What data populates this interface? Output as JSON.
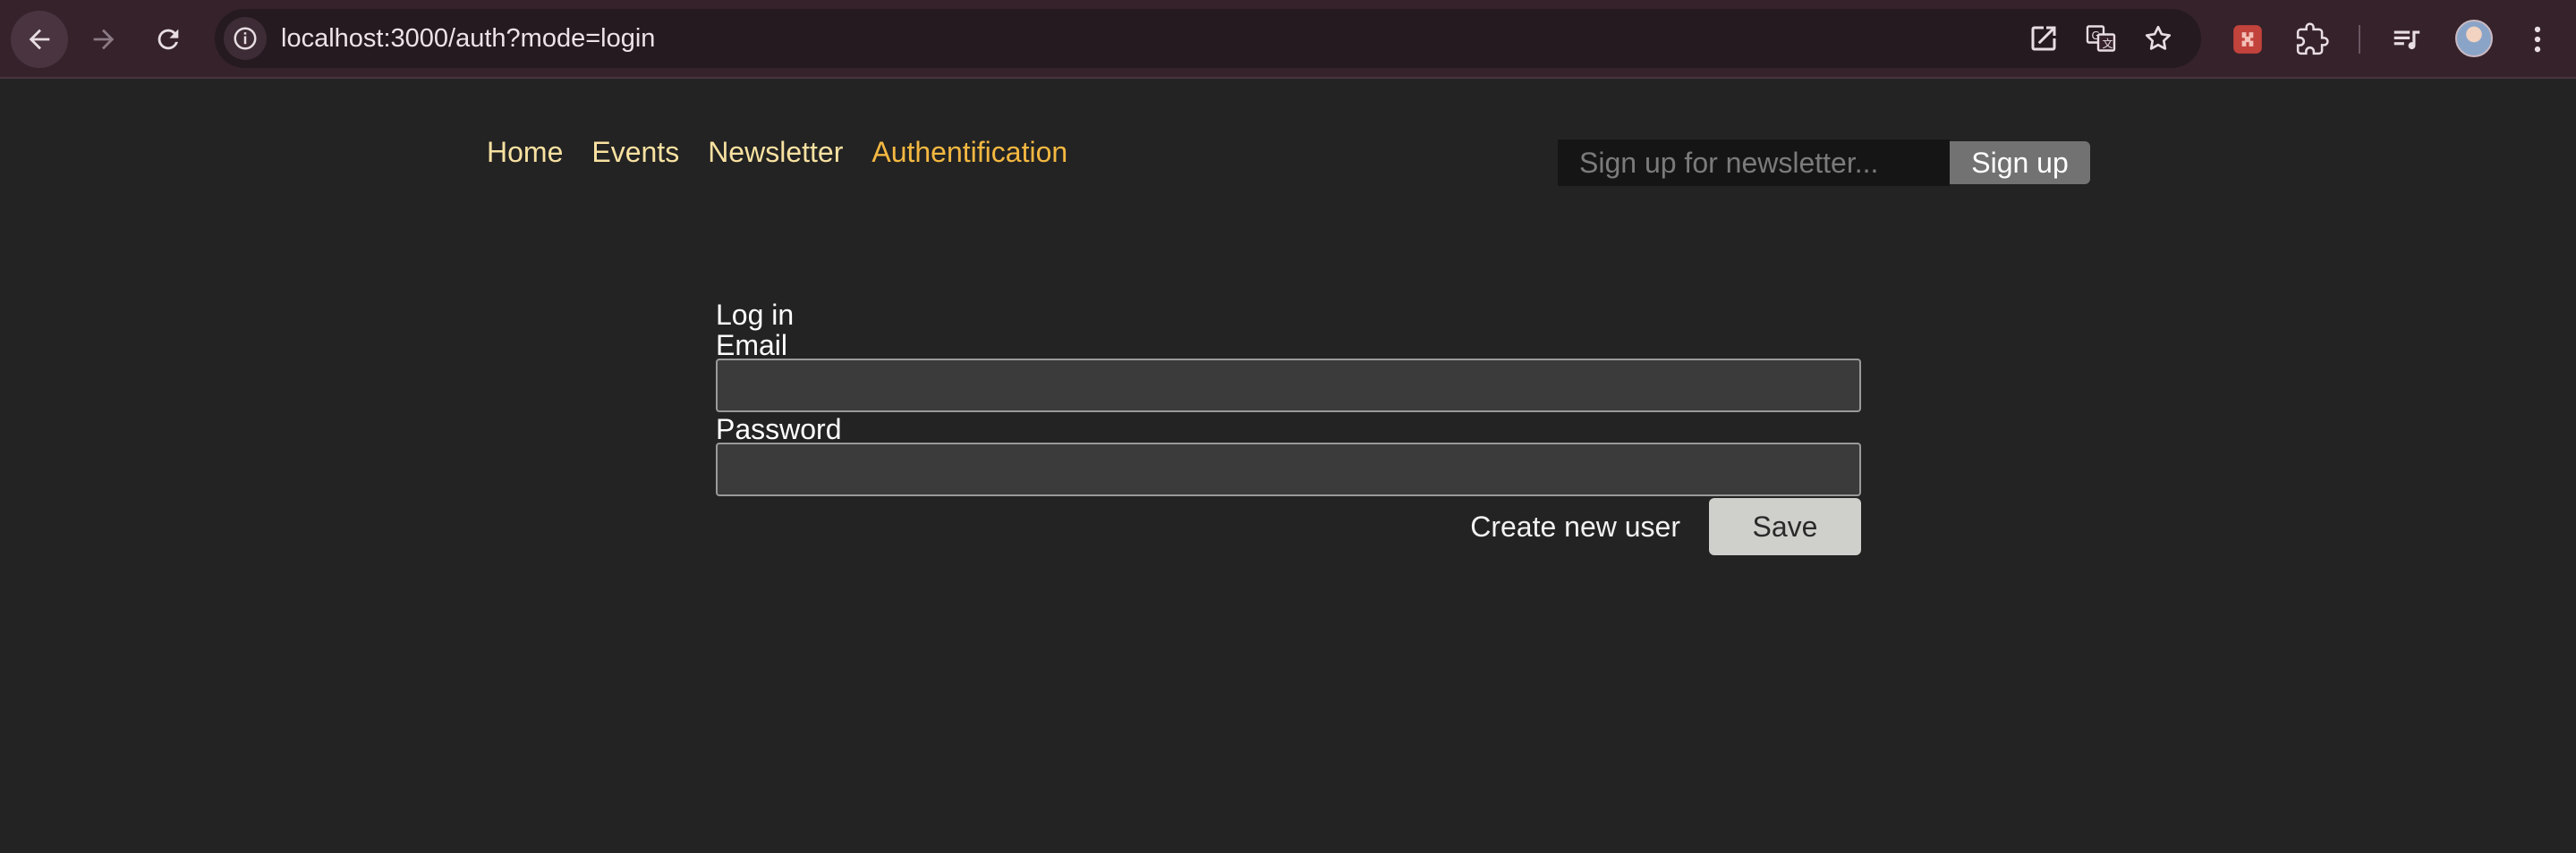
{
  "browser": {
    "url": "localhost:3000/auth?mode=login",
    "icons": [
      "back-arrow-icon",
      "forward-arrow-icon",
      "reload-icon",
      "site-info-icon",
      "open-in-new-icon",
      "translate-icon",
      "bookmark-star-icon",
      "extension-icon",
      "puzzle-icon",
      "media-control-icon",
      "profile-avatar",
      "more-menu-icon"
    ]
  },
  "nav": {
    "home": "Home",
    "events": "Events",
    "newsletter": "Newsletter",
    "auth": "Authentification"
  },
  "newsletter": {
    "placeholder": "Sign up for newsletter...",
    "button": "Sign up"
  },
  "form": {
    "heading": "Log in",
    "email_label": "Email",
    "email_value": "",
    "password_label": "Password",
    "password_value": "",
    "create_user": "Create new user",
    "save": "Save"
  },
  "colors": {
    "page_bg": "#232323",
    "nav_link": "#f8e1a1",
    "nav_active": "#f4b841",
    "browser_chrome": "#35222b"
  }
}
